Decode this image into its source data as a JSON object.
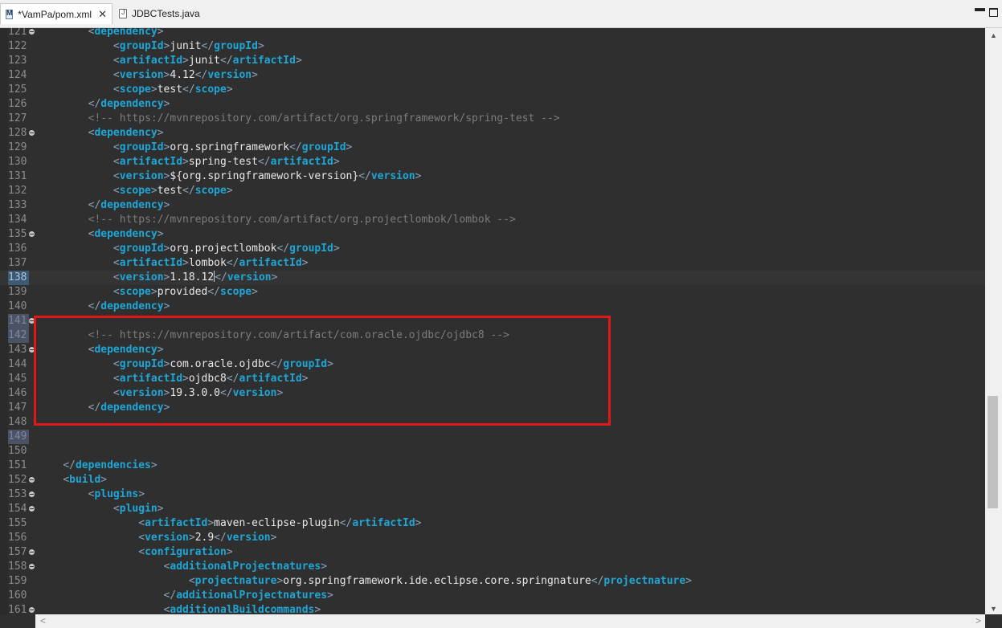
{
  "tabs": [
    {
      "label": "*VamPa/pom.xml",
      "icon": "xml-file-icon",
      "active": true
    },
    {
      "label": "JDBCTests.java",
      "icon": "java-file-icon",
      "active": false
    }
  ],
  "window_controls": {
    "minimize": "minimize-icon",
    "maximize": "maximize-icon"
  },
  "editor": {
    "current_line": 138,
    "highlight_color": "#e01818",
    "lines": [
      {
        "n": 121,
        "fold": true,
        "indent": 2,
        "kind": "open",
        "tag": "dependency"
      },
      {
        "n": 122,
        "fold": false,
        "indent": 3,
        "kind": "elem",
        "tag": "groupId",
        "text": "junit"
      },
      {
        "n": 123,
        "fold": false,
        "indent": 3,
        "kind": "elem",
        "tag": "artifactId",
        "text": "junit"
      },
      {
        "n": 124,
        "fold": false,
        "indent": 3,
        "kind": "elem",
        "tag": "version",
        "text": "4.12"
      },
      {
        "n": 125,
        "fold": false,
        "indent": 3,
        "kind": "elem",
        "tag": "scope",
        "text": "test"
      },
      {
        "n": 126,
        "fold": false,
        "indent": 2,
        "kind": "close",
        "tag": "dependency"
      },
      {
        "n": 127,
        "fold": false,
        "indent": 2,
        "kind": "comment",
        "text": "<!-- https://mvnrepository.com/artifact/org.springframework/spring-test -->"
      },
      {
        "n": 128,
        "fold": true,
        "indent": 2,
        "kind": "open",
        "tag": "dependency"
      },
      {
        "n": 129,
        "fold": false,
        "indent": 3,
        "kind": "elem",
        "tag": "groupId",
        "text": "org.springframework"
      },
      {
        "n": 130,
        "fold": false,
        "indent": 3,
        "kind": "elem",
        "tag": "artifactId",
        "text": "spring-test"
      },
      {
        "n": 131,
        "fold": false,
        "indent": 3,
        "kind": "elem",
        "tag": "version",
        "text": "${org.springframework-version}"
      },
      {
        "n": 132,
        "fold": false,
        "indent": 3,
        "kind": "elem",
        "tag": "scope",
        "text": "test"
      },
      {
        "n": 133,
        "fold": false,
        "indent": 2,
        "kind": "close",
        "tag": "dependency"
      },
      {
        "n": 134,
        "fold": false,
        "indent": 2,
        "kind": "comment",
        "text": "<!-- https://mvnrepository.com/artifact/org.projectlombok/lombok -->"
      },
      {
        "n": 135,
        "fold": true,
        "indent": 2,
        "kind": "open",
        "tag": "dependency"
      },
      {
        "n": 136,
        "fold": false,
        "indent": 3,
        "kind": "elem",
        "tag": "groupId",
        "text": "org.projectlombok"
      },
      {
        "n": 137,
        "fold": false,
        "indent": 3,
        "kind": "elem",
        "tag": "artifactId",
        "text": "lombok"
      },
      {
        "n": 138,
        "fold": false,
        "indent": 3,
        "kind": "elem",
        "tag": "version",
        "text": "1.18.12",
        "caret": true
      },
      {
        "n": 139,
        "fold": false,
        "indent": 3,
        "kind": "elem",
        "tag": "scope",
        "text": "provided"
      },
      {
        "n": 140,
        "fold": false,
        "indent": 2,
        "kind": "close",
        "tag": "dependency"
      },
      {
        "n": 141,
        "fold": true,
        "indent": 0,
        "kind": "blank",
        "sel": true
      },
      {
        "n": 142,
        "fold": false,
        "indent": 2,
        "kind": "comment",
        "text": "<!-- https://mvnrepository.com/artifact/com.oracle.ojdbc/ojdbc8 -->",
        "sel": true
      },
      {
        "n": 143,
        "fold": true,
        "indent": 2,
        "kind": "open",
        "tag": "dependency"
      },
      {
        "n": 144,
        "fold": false,
        "indent": 3,
        "kind": "elem",
        "tag": "groupId",
        "text": "com.oracle.ojdbc"
      },
      {
        "n": 145,
        "fold": false,
        "indent": 3,
        "kind": "elem",
        "tag": "artifactId",
        "text": "ojdbc8"
      },
      {
        "n": 146,
        "fold": false,
        "indent": 3,
        "kind": "elem",
        "tag": "version",
        "text": "19.3.0.0"
      },
      {
        "n": 147,
        "fold": false,
        "indent": 2,
        "kind": "close",
        "tag": "dependency"
      },
      {
        "n": 148,
        "fold": false,
        "indent": 0,
        "kind": "blank"
      },
      {
        "n": 149,
        "fold": false,
        "indent": 0,
        "kind": "blank",
        "sel": true
      },
      {
        "n": 150,
        "fold": false,
        "indent": 0,
        "kind": "blank"
      },
      {
        "n": 151,
        "fold": false,
        "indent": 1,
        "kind": "close",
        "tag": "dependencies"
      },
      {
        "n": 152,
        "fold": true,
        "indent": 1,
        "kind": "open",
        "tag": "build"
      },
      {
        "n": 153,
        "fold": true,
        "indent": 2,
        "kind": "open",
        "tag": "plugins"
      },
      {
        "n": 154,
        "fold": true,
        "indent": 3,
        "kind": "open",
        "tag": "plugin"
      },
      {
        "n": 155,
        "fold": false,
        "indent": 4,
        "kind": "elem",
        "tag": "artifactId",
        "text": "maven-eclipse-plugin"
      },
      {
        "n": 156,
        "fold": false,
        "indent": 4,
        "kind": "elem",
        "tag": "version",
        "text": "2.9"
      },
      {
        "n": 157,
        "fold": true,
        "indent": 4,
        "kind": "open",
        "tag": "configuration"
      },
      {
        "n": 158,
        "fold": true,
        "indent": 5,
        "kind": "open",
        "tag": "additionalProjectnatures"
      },
      {
        "n": 159,
        "fold": false,
        "indent": 6,
        "kind": "elem",
        "tag": "projectnature",
        "text": "org.springframework.ide.eclipse.core.springnature"
      },
      {
        "n": 160,
        "fold": false,
        "indent": 5,
        "kind": "close",
        "tag": "additionalProjectnatures"
      },
      {
        "n": 161,
        "fold": true,
        "indent": 5,
        "kind": "open",
        "tag": "additionalBuildcommands"
      }
    ]
  },
  "scrollbars": {
    "up": "▲",
    "down": "▼",
    "left": "<",
    "right": ">"
  }
}
